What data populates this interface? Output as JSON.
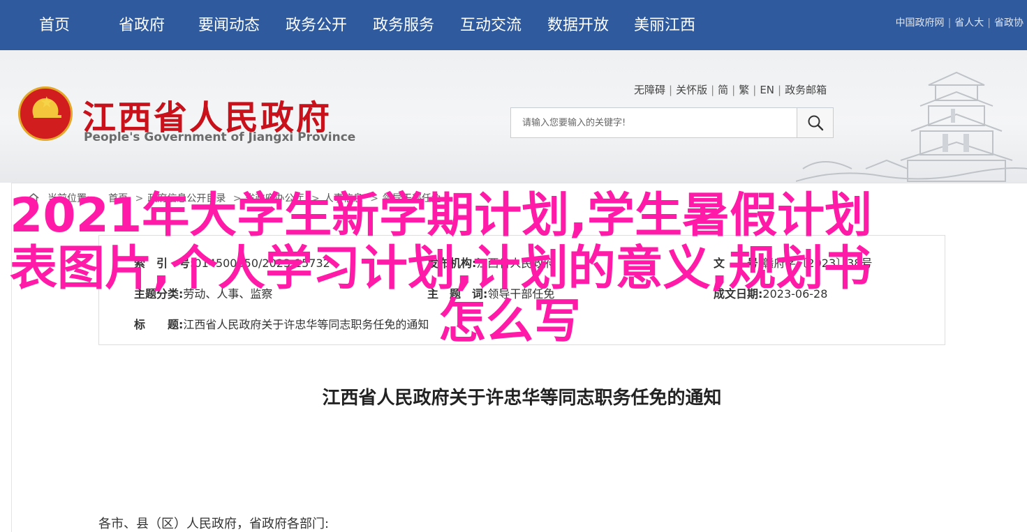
{
  "topnav": {
    "items": [
      "首页",
      "省政府",
      "要闻动态",
      "政务公开",
      "政务服务",
      "互动交流",
      "数据开放",
      "美丽江西"
    ],
    "links": [
      "中国政府网",
      "省人大",
      "省政协"
    ]
  },
  "header": {
    "title": "江西省人民政府",
    "subtitle": "People's Government of Jiangxi Province",
    "util_links": [
      "无障碍",
      "关怀版",
      "简",
      "繁",
      "EN",
      "政务邮箱"
    ],
    "search": {
      "placeholder": "请输入您要输入的关键字!"
    }
  },
  "breadcrumb": {
    "label": "当前位置:",
    "items": [
      "首页",
      "政府信息公开目录",
      "省政府办公厅",
      "人事信息",
      "领导干部任免"
    ]
  },
  "info": {
    "index_label": "索　引　号:",
    "index_value": "014500850/2023-15732",
    "publisher_label": "发布机构:",
    "publisher_value": "江西省人民政府",
    "docno_label": "文　　号:",
    "docno_value": "赣府字〔2023〕38号",
    "category_label": "主题分类:",
    "category_value": "劳动、人事、监察",
    "subject_label": "主　题　词:",
    "subject_value": "领导干部任免",
    "date_label": "成文日期:",
    "date_value": "2023-06-28",
    "title_label": "标　　题:",
    "title_value": "江西省人民政府关于许忠华等同志职务任免的通知"
  },
  "document": {
    "title": "江西省人民政府关于许忠华等同志职务任免的通知",
    "first_paragraph": "各市、县（区）人民政府，省政府各部门:"
  },
  "overlay": {
    "line1": "2021年大学生新学期计划,学生暑假计划",
    "line2": "表图片,个人学习计划,计划的意义,规划书",
    "line3": "怎么写",
    "color": "#ff1aa8"
  },
  "colors": {
    "nav_bg": "#2f5b9e",
    "title_red": "#c8111b"
  }
}
